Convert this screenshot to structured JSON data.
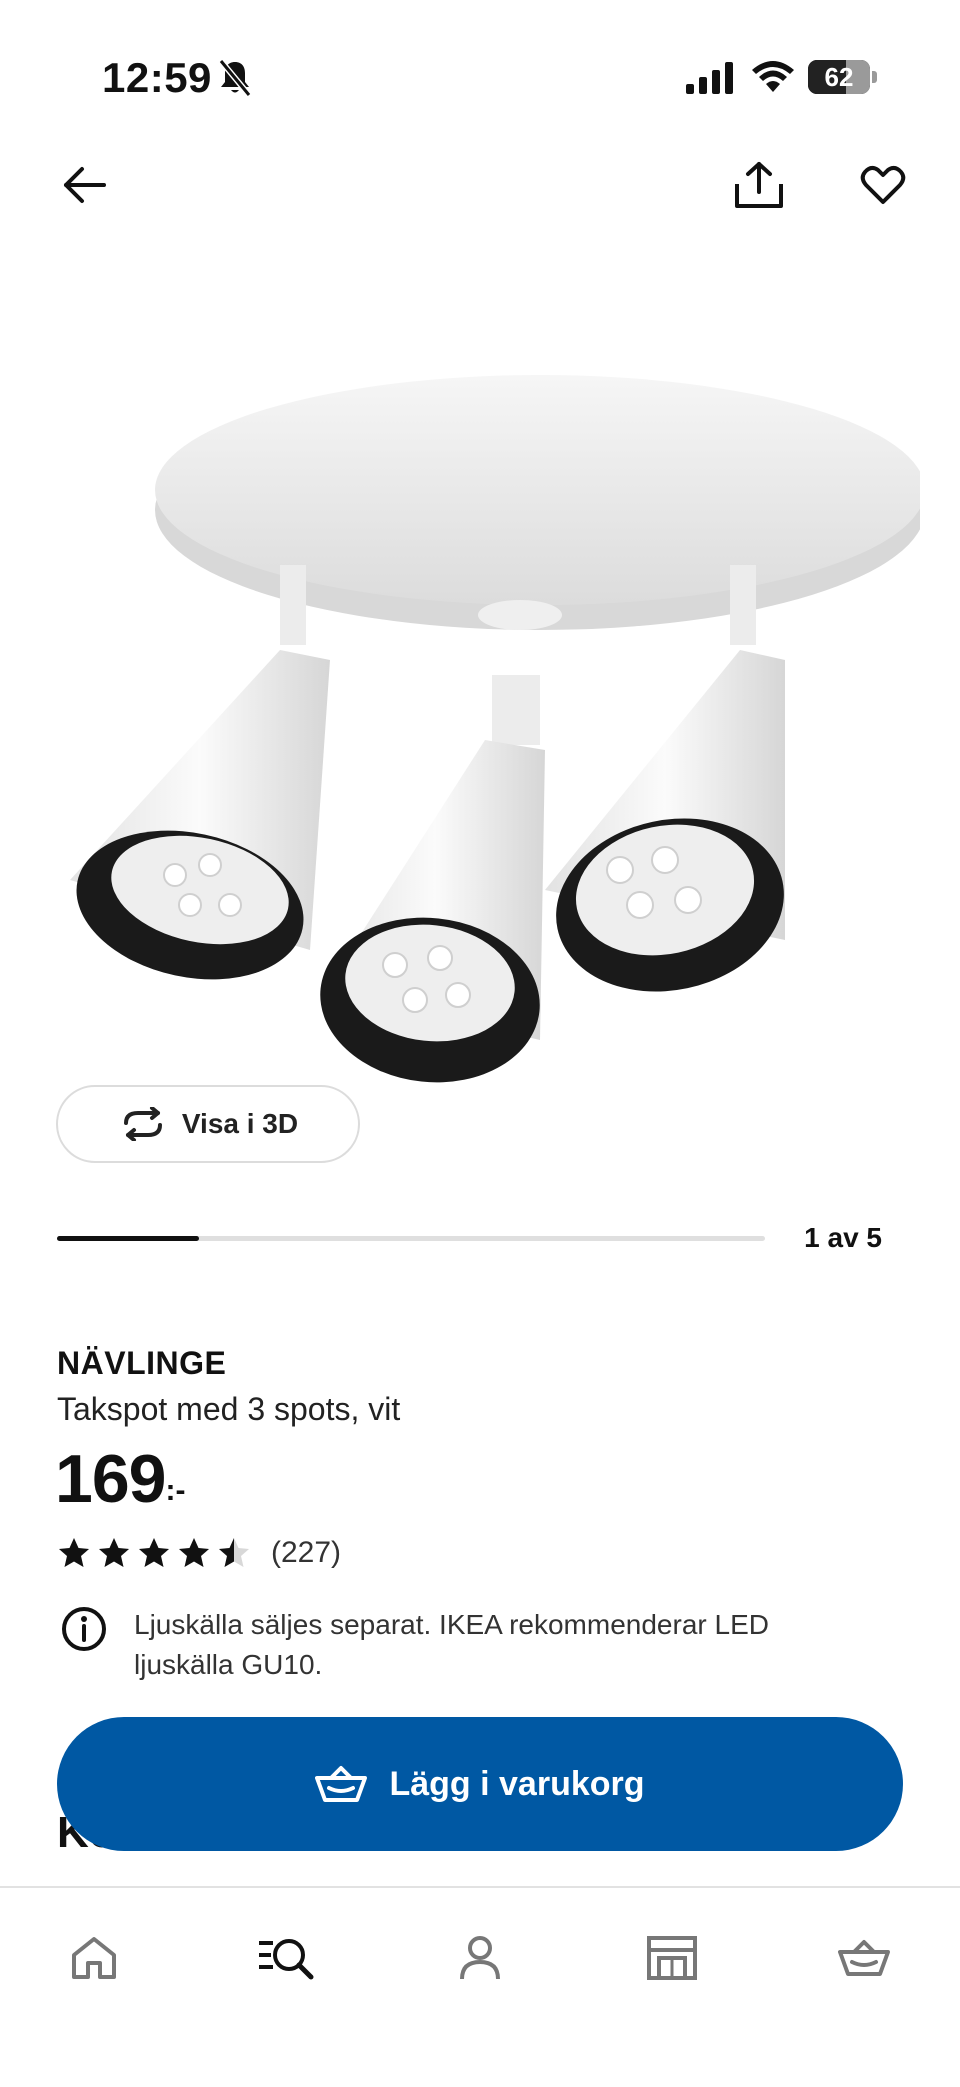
{
  "status_bar": {
    "time": "12:59",
    "battery_level": "62",
    "battery_fraction": 0.62
  },
  "icons": {
    "back": "arrow-left-icon",
    "share": "share-icon",
    "favorite": "heart-icon",
    "view3d": "rotate-3d-icon",
    "info": "info-icon",
    "cart": "basket-icon"
  },
  "gallery": {
    "view3d_label": "Visa i 3D",
    "counter": "1 av 5",
    "current": 1,
    "total": 5
  },
  "product": {
    "name": "NÄVLINGE",
    "description": "Takspot med 3 spots, vit",
    "price_integer": "169",
    "price_suffix": ":-",
    "rating": 4.5,
    "rating_max": 5,
    "review_count": "(227)",
    "info_text": "Ljuskälla säljes separat. IKEA rekommenderar LED ljuskälla GU10.",
    "partial_heading": "Kö"
  },
  "cta": {
    "add_to_cart_label": "Lägg i varukorg",
    "color": "#0058a3"
  },
  "bottom_nav": {
    "tabs": [
      {
        "name": "home",
        "icon": "home-icon",
        "active": false
      },
      {
        "name": "search",
        "icon": "search-icon",
        "active": true
      },
      {
        "name": "profile",
        "icon": "profile-icon",
        "active": false
      },
      {
        "name": "store",
        "icon": "store-icon",
        "active": false
      },
      {
        "name": "cart",
        "icon": "basket-icon",
        "active": false
      }
    ]
  }
}
